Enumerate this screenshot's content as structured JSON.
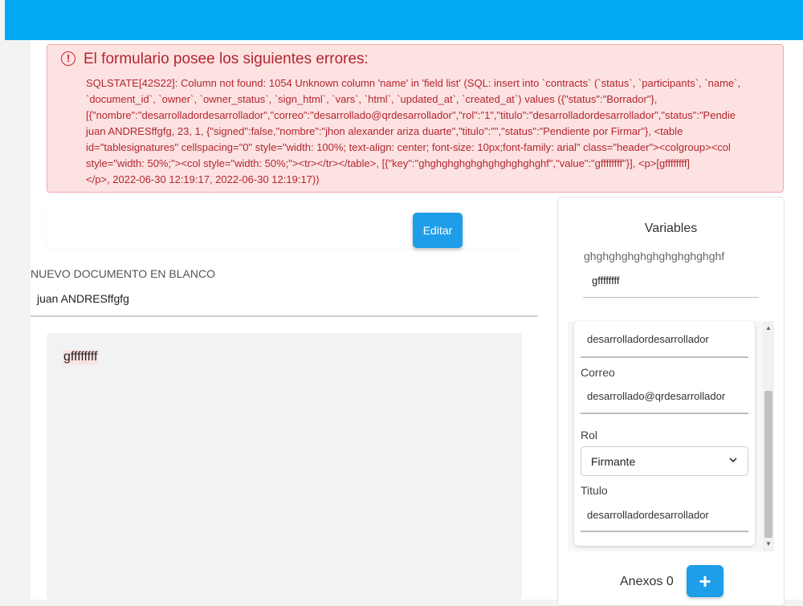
{
  "alert": {
    "title": "El formulario posee los siguientes errores:",
    "lines": [
      "SQLSTATE[42S22]: Column not found: 1054 Unknown column 'name' in 'field list' (SQL: insert into `contracts` (`status`, `participants`, `name`,",
      "`document_id`, `owner`, `owner_status`, `sign_html`, `vars`, `html`, `updated_at`, `created_at`) values ({\"status\":\"Borrador\"},",
      "[{\"nombre\":\"desarrolladordesarrollador\",\"correo\":\"desarrollado@qrdesarrollador\",\"rol\":\"1\",\"titulo\":\"desarrolladordesarrollador\",\"status\":\"Pendie",
      "juan ANDRESffgfg, 23, 1, {\"signed\":false,\"nombre\":\"jhon alexander ariza duarte\",\"titulo\":\"\",\"status\":\"Pendiente por Firmar\"}, <table",
      "id=\"tablesignatures\" cellspacing=\"0\" style=\"width: 100%; text-align: center; font-size: 10px;font-family: arial\" class=\"header\"><colgroup><col",
      "style=\"width: 50%;\"><col style=\"width: 50%;\"><tr></tr></table>, [{\"key\":\"ghghghghghghghghghghghf\",\"value\":\"gffffffff\"}], <p>[gffffffff]",
      "</p>, 2022-06-30 12:19:17, 2022-06-30 12:19:17))"
    ]
  },
  "toolbar": {
    "edit_label": "Editar"
  },
  "document": {
    "type_label": "NUEVO DOCUMENTO EN BLANCO",
    "name": "juan ANDRESffgfg",
    "content": "gffffffff"
  },
  "variables": {
    "title": "Variables",
    "key": "ghghghghghghghghghghghf",
    "value": "gffffffff"
  },
  "signer": {
    "nombre_value": "desarrolladordesarrollador",
    "correo_label": "Correo",
    "correo_value": "desarrollado@qrdesarrollador",
    "rol_label": "Rol",
    "rol_value": "Firmante",
    "titulo_label": "Titulo",
    "titulo_value": "desarrolladordesarrollador"
  },
  "anexos": {
    "label": "Anexos 0",
    "add_icon": "plus-icon"
  },
  "colors": {
    "topbar": "#03a9f4",
    "button": "#1e9ee8",
    "alert_bg": "#fde2e2",
    "alert_text": "#b3262f"
  }
}
